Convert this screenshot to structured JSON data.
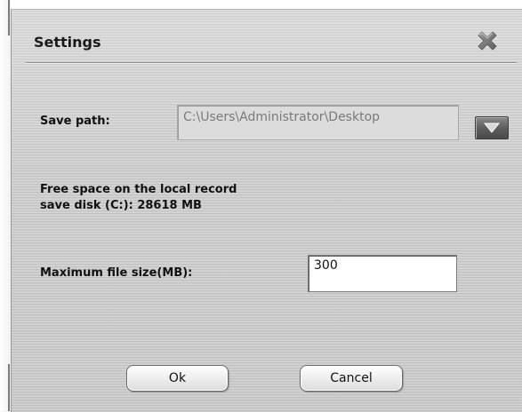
{
  "dialog": {
    "title": "Settings",
    "close_icon": "close-icon"
  },
  "save_path": {
    "label": "Save path:",
    "value": "C:\\Users\\Administrator\\Desktop",
    "browse_icon": "chevron-down-icon"
  },
  "free_space": {
    "line1": "Free space on the local record",
    "line2": "save disk (C:): 28618 MB"
  },
  "max_file_size": {
    "label": "Maximum file size(MB):",
    "value": "300"
  },
  "buttons": {
    "ok_label": "Ok",
    "cancel_label": "Cancel"
  }
}
